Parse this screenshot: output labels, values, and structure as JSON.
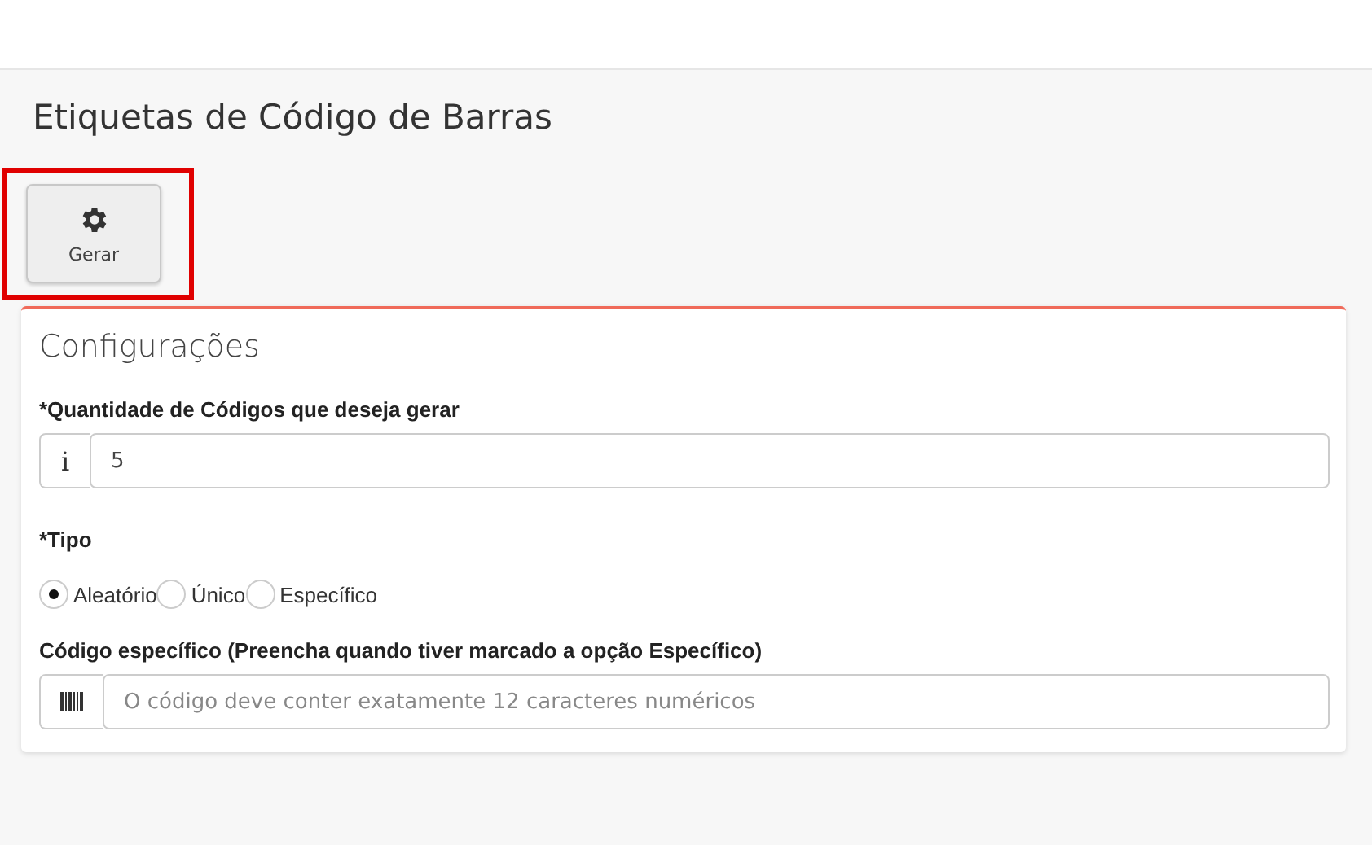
{
  "page": {
    "title": "Etiquetas de Código de Barras"
  },
  "toolbar": {
    "button": {
      "label": "Gerar",
      "highlighted": true
    }
  },
  "card": {
    "title": "Configurações",
    "quantity": {
      "label": "*Quantidade de Códigos que deseja gerar",
      "prefix": "i",
      "value": "5"
    },
    "type": {
      "label": "*Tipo",
      "options": [
        {
          "label": "Aleatório",
          "selected": true
        },
        {
          "label": "Único",
          "selected": false
        },
        {
          "label": "Específico",
          "selected": false
        }
      ]
    },
    "specific_code": {
      "label": "Código específico (Preencha quando tiver marcado a opção Específico)",
      "placeholder": "O código deve conter exatamente 12 caracteres numéricos"
    }
  }
}
